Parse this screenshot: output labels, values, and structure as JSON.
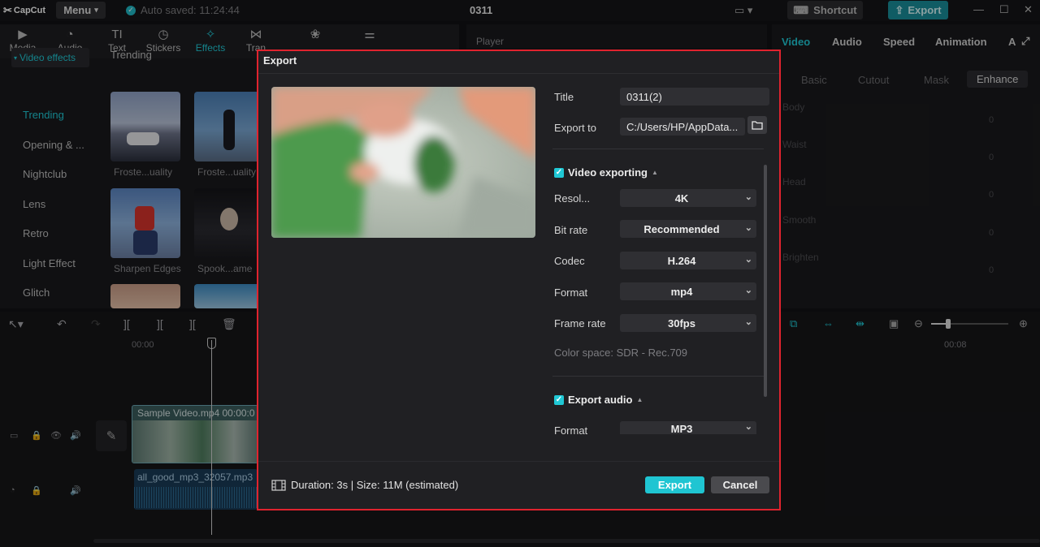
{
  "app": {
    "logo": "CapCut",
    "menu_label": "Menu",
    "autosave": "Auto saved: 11:24:44",
    "project_title": "0311",
    "shortcut_label": "Shortcut",
    "export_label": "Export"
  },
  "media_tabs": [
    {
      "label": "Media",
      "icon": "media-icon"
    },
    {
      "label": "Audio",
      "icon": "audio-icon"
    },
    {
      "label": "Text",
      "icon": "text-icon"
    },
    {
      "label": "Stickers",
      "icon": "stickers-icon"
    },
    {
      "label": "Effects",
      "icon": "effects-icon"
    },
    {
      "label": "Tran",
      "icon": "transitions-icon"
    }
  ],
  "sidebar": {
    "section": "Video effects",
    "items": [
      "Trending",
      "Opening & ...",
      "Nightclub",
      "Lens",
      "Retro",
      "Light Effect",
      "Glitch"
    ]
  },
  "effects": {
    "heading": "Trending",
    "thumbs": [
      "Froste...uality",
      "Froste...uality",
      "Sharpen Edges",
      "Spook...ame"
    ]
  },
  "player": {
    "label": "Player"
  },
  "right_panel": {
    "tabs": [
      "Video",
      "Audio",
      "Speed",
      "Animation",
      "A"
    ],
    "subtabs": [
      "Basic",
      "Cutout",
      "Mask",
      "Enhance"
    ],
    "sliders": [
      {
        "label": "Body",
        "value": "0"
      },
      {
        "label": "Waist",
        "value": "0"
      },
      {
        "label": "Head",
        "value": "0"
      },
      {
        "label": "Smooth",
        "value": "0"
      },
      {
        "label": "Brighten",
        "value": "0"
      }
    ]
  },
  "timeline": {
    "time_start": "00:00",
    "time_end": "00:08",
    "video_clip": "Sample Video.mp4   00:00:0",
    "audio_clip": "all_good_mp3_32057.mp3"
  },
  "dialog": {
    "title": "Export",
    "title_label": "Title",
    "title_value": "0311(2)",
    "export_to_label": "Export to",
    "export_to_value": "C:/Users/HP/AppData...",
    "video_section": "Video exporting",
    "resolution_label": "Resol...",
    "resolution_value": "4K",
    "bitrate_label": "Bit rate",
    "bitrate_value": "Recommended",
    "codec_label": "Codec",
    "codec_value": "H.264",
    "format_label": "Format",
    "format_value": "mp4",
    "framerate_label": "Frame rate",
    "framerate_value": "30fps",
    "colorspace": "Color space: SDR - Rec.709",
    "audio_section": "Export audio",
    "audio_format_label": "Format",
    "audio_format_value": "MP3",
    "duration": "Duration: 3s | Size: 11M (estimated)",
    "export_button": "Export",
    "cancel_button": "Cancel"
  },
  "colors": {
    "accent": "#20c8d5",
    "highlight_border": "#e0232e",
    "dialog_bg": "#202023"
  }
}
